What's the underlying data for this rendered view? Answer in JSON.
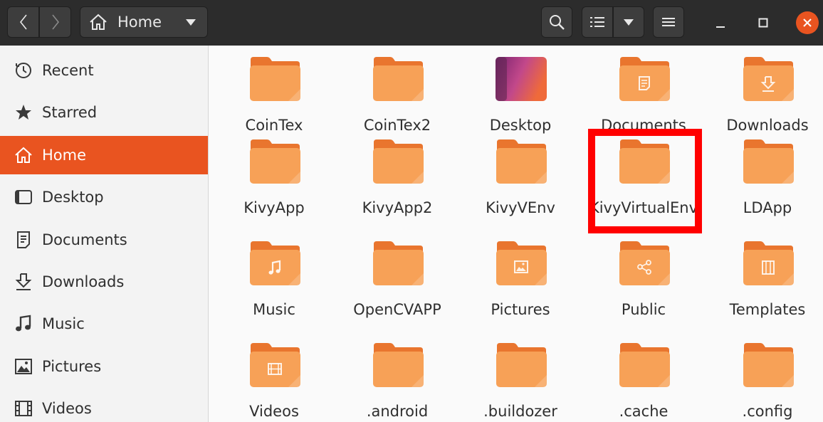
{
  "header": {
    "location_label": "Home",
    "icons": {
      "back": "chevron-left-icon",
      "forward": "chevron-right-icon",
      "home": "home-icon",
      "search": "search-icon",
      "view": "list-view-icon",
      "menu": "hamburger-menu-icon"
    }
  },
  "sidebar": {
    "items": [
      {
        "label": "Recent",
        "icon": "clock-icon"
      },
      {
        "label": "Starred",
        "icon": "star-icon"
      },
      {
        "label": "Home",
        "icon": "home-icon",
        "active": true
      },
      {
        "label": "Desktop",
        "icon": "desktop-icon"
      },
      {
        "label": "Documents",
        "icon": "document-icon"
      },
      {
        "label": "Downloads",
        "icon": "download-icon"
      },
      {
        "label": "Music",
        "icon": "music-note-icon"
      },
      {
        "label": "Pictures",
        "icon": "picture-icon"
      },
      {
        "label": "Videos",
        "icon": "film-icon"
      }
    ]
  },
  "files": [
    {
      "label": "CoinTex",
      "emblem": "none"
    },
    {
      "label": "CoinTex2",
      "emblem": "none"
    },
    {
      "label": "Desktop",
      "emblem": "desktop"
    },
    {
      "label": "Documents",
      "emblem": "document"
    },
    {
      "label": "Downloads",
      "emblem": "download"
    },
    {
      "label": "KivyApp",
      "emblem": "none"
    },
    {
      "label": "KivyApp2",
      "emblem": "none"
    },
    {
      "label": "KivyVEnv",
      "emblem": "none"
    },
    {
      "label": "KivyVirtualEnv",
      "emblem": "none",
      "highlighted": true
    },
    {
      "label": "LDApp",
      "emblem": "none"
    },
    {
      "label": "Music",
      "emblem": "music"
    },
    {
      "label": "OpenCVAPP",
      "emblem": "none"
    },
    {
      "label": "Pictures",
      "emblem": "picture"
    },
    {
      "label": "Public",
      "emblem": "share"
    },
    {
      "label": "Templates",
      "emblem": "template"
    },
    {
      "label": "Videos",
      "emblem": "film"
    },
    {
      "label": ".android",
      "emblem": "none"
    },
    {
      "label": ".buildozer",
      "emblem": "none"
    },
    {
      "label": ".cache",
      "emblem": "none"
    },
    {
      "label": ".config",
      "emblem": "none"
    }
  ],
  "colors": {
    "accent": "#e95420",
    "folder_body": "#f7a157",
    "folder_tab": "#e9752e",
    "highlight": "#ff0000"
  }
}
